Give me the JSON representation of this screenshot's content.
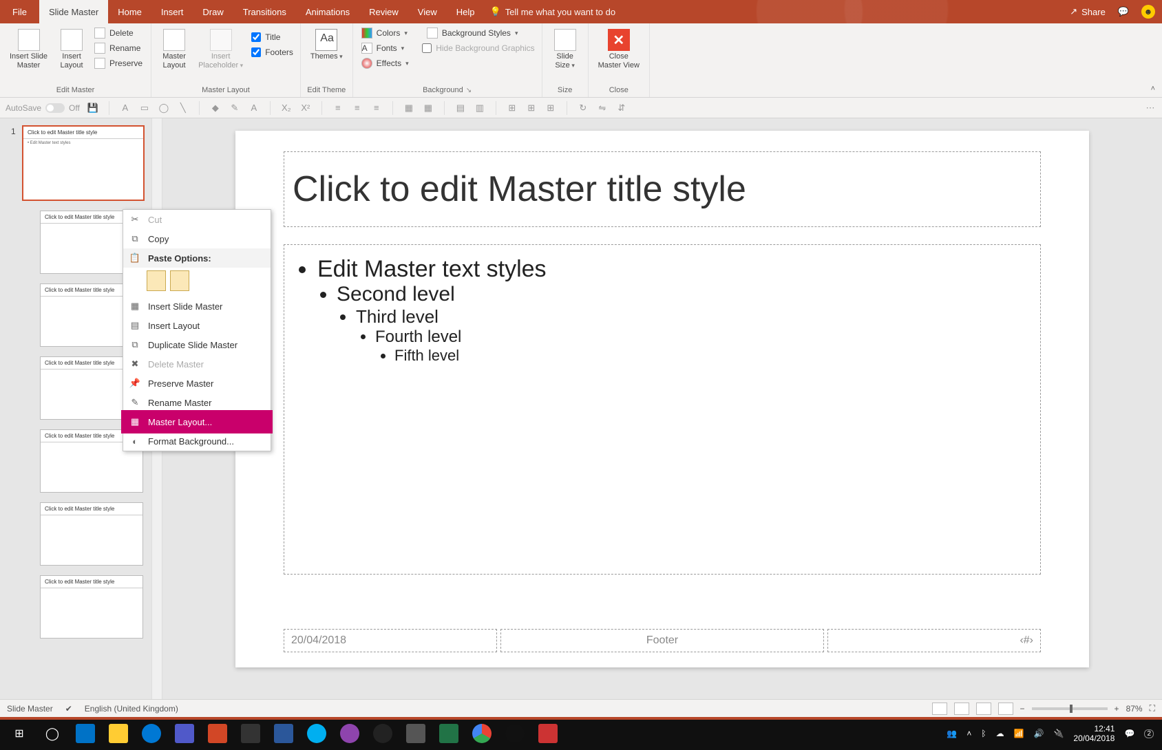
{
  "tabs": {
    "file": "File",
    "slide_master": "Slide Master",
    "home": "Home",
    "insert": "Insert",
    "draw": "Draw",
    "transitions": "Transitions",
    "animations": "Animations",
    "review": "Review",
    "view": "View",
    "help": "Help",
    "tellme": "Tell me what you want to do",
    "share": "Share"
  },
  "ribbon": {
    "edit_master": {
      "insert_slide_master": "Insert Slide\nMaster",
      "insert_layout": "Insert\nLayout",
      "delete": "Delete",
      "rename": "Rename",
      "preserve": "Preserve",
      "label": "Edit Master"
    },
    "master_layout": {
      "master_layout": "Master\nLayout",
      "insert_placeholder": "Insert\nPlaceholder",
      "title": "Title",
      "footers": "Footers",
      "label": "Master Layout"
    },
    "edit_theme": {
      "themes": "Themes",
      "label": "Edit Theme"
    },
    "background": {
      "colors": "Colors",
      "fonts": "Fonts",
      "effects": "Effects",
      "bg_styles": "Background Styles",
      "hide_bg": "Hide Background Graphics",
      "label": "Background"
    },
    "size": {
      "slide_size": "Slide\nSize",
      "label": "Size"
    },
    "close": {
      "close_master": "Close\nMaster View",
      "label": "Close"
    }
  },
  "qat": {
    "autosave": "AutoSave",
    "off": "Off"
  },
  "slide": {
    "title": "Click to edit Master title style",
    "l1": "Edit Master text styles",
    "l2": "Second level",
    "l3": "Third level",
    "l4": "Fourth level",
    "l5": "Fifth level",
    "date": "20/04/2018",
    "footer": "Footer",
    "num": "‹#›"
  },
  "thumb": {
    "master_num": "1",
    "title": "Click to edit Master title style",
    "body": "• Edit Master text styles"
  },
  "context": {
    "cut": "Cut",
    "copy": "Copy",
    "paste_options": "Paste Options:",
    "insert_slide_master": "Insert Slide Master",
    "insert_layout": "Insert Layout",
    "duplicate": "Duplicate Slide Master",
    "delete": "Delete Master",
    "preserve": "Preserve Master",
    "rename": "Rename Master",
    "master_layout": "Master Layout...",
    "format_bg": "Format Background..."
  },
  "status": {
    "mode": "Slide Master",
    "lang": "English (United Kingdom)",
    "zoom": "87%"
  },
  "taskbar": {
    "time": "12:41",
    "date": "20/04/2018",
    "notif": "2"
  }
}
